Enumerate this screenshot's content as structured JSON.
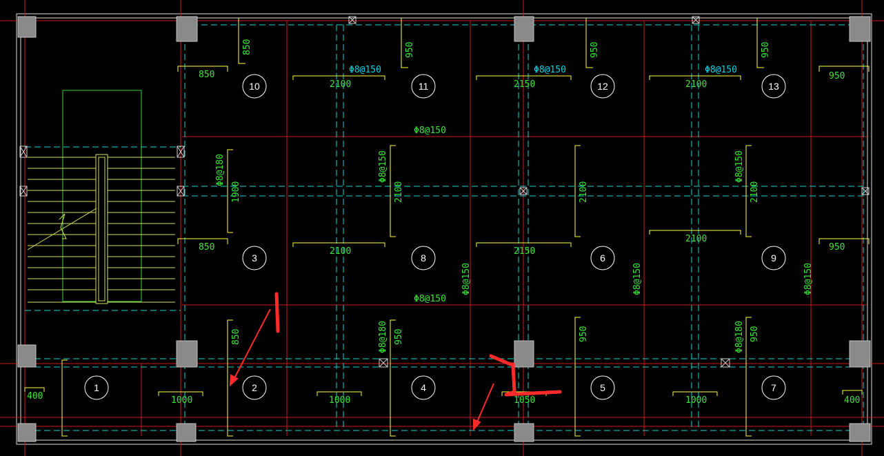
{
  "colors": {
    "background": "#000000",
    "grid_axis": "#d11a1a",
    "beam_dash": "#19d3d3",
    "outline": "#e0e0e0",
    "rebar_text": "#00d7e8",
    "dim_text": "#39e639",
    "support_bar": "#ffff3c",
    "column": "#8a8a8a",
    "annotation": "#ff2a2a",
    "stair": "#d6e05a"
  },
  "panels": [
    "1",
    "2",
    "3",
    "4",
    "5",
    "6",
    "7",
    "8",
    "9",
    "10",
    "11",
    "12",
    "13"
  ],
  "rebar_labels": {
    "top_row_1": "Φ8@150",
    "top_row_2": "Φ8@150",
    "top_row_3": "Φ8@150",
    "mid_upper": "Φ8@150",
    "mid_lower": "Φ8@150",
    "left_vertical": "Φ8@180",
    "col2_vertical": "Φ8@150",
    "col4_vertical": "Φ8@150",
    "mid_v_left": "Φ8@150",
    "mid_v_center": "Φ8@150",
    "mid_v_right": "Φ8@150",
    "low_v_1": "Φ8@180",
    "low_v_2": "Φ8@180"
  },
  "dimensions": {
    "d850_top_a": "850",
    "d850_top_b": "850",
    "d950_top_a": "950",
    "d950_top_b": "950",
    "d950_top_c": "950",
    "d950_top_right": "950",
    "d2100_a": "2100",
    "d2150_a": "2150",
    "d2100_b": "2100",
    "d1900": "1900",
    "d2100_v1": "2100",
    "d2100_v2": "2100",
    "d2100_v3": "2100",
    "d850_mid": "850",
    "d2100_c": "2100",
    "d2150_b": "2150",
    "d2100_d": "2100",
    "d950_mid": "950",
    "d850_low": "850",
    "d950_low_a": "950",
    "d950_low_b": "950",
    "d950_low_c": "950",
    "d400_l": "400",
    "d1000_a": "1000",
    "d1000_b": "1000",
    "d1050": "1050",
    "d1000_c": "1000",
    "d400_r": "400"
  },
  "annotations": {
    "mark_1": "1",
    "mark_2": "2"
  }
}
